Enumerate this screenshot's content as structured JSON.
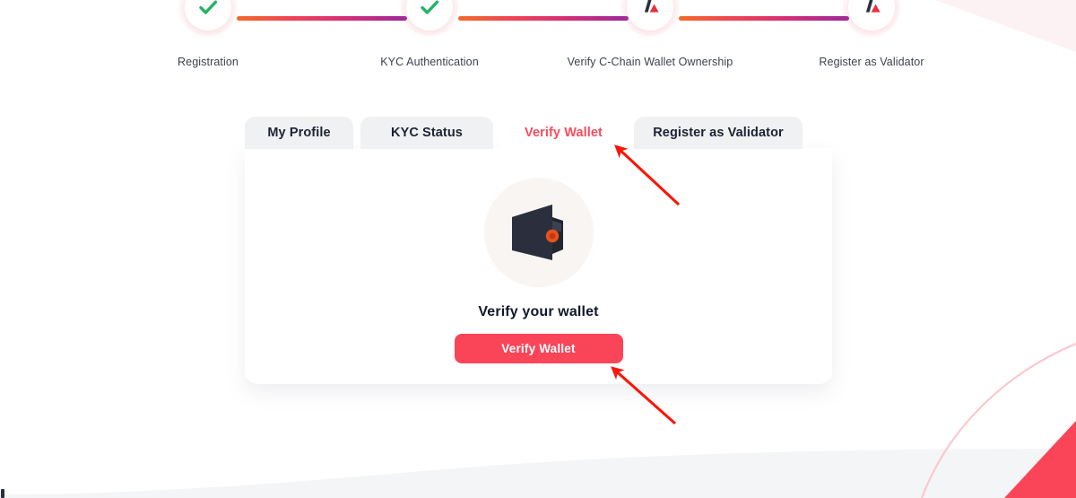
{
  "theme": {
    "accent_red": "#fa4558",
    "accent_red_text": "#fa4c5e",
    "check_green": "#24b364",
    "connector_start": "#f26a2b",
    "connector_mid": "#d62f74",
    "connector_end": "#9b2a9b",
    "tab_inactive_bg": "#f0f1f3",
    "card_bg": "#ffffff",
    "wallet_body": "#2b2f3d",
    "wallet_clasp": "#e8521f",
    "page_bg": "#ffffff",
    "annotation_arrow": "#fb1508"
  },
  "stepper": {
    "steps": [
      {
        "label": "Registration",
        "state": "complete",
        "icon": "check-icon"
      },
      {
        "label": "KYC Authentication",
        "state": "complete",
        "icon": "check-icon"
      },
      {
        "label": "Verify C-Chain Wallet Ownership",
        "state": "current",
        "icon": "avalanche-logo-icon"
      },
      {
        "label": "Register as Validator",
        "state": "upcoming",
        "icon": "avalanche-logo-icon"
      }
    ]
  },
  "tabs": [
    {
      "label": "My Profile",
      "active": false
    },
    {
      "label": "KYC Status",
      "active": false
    },
    {
      "label": "Verify Wallet",
      "active": true
    },
    {
      "label": "Register as Validator",
      "active": false
    }
  ],
  "card": {
    "illustration": "wallet-icon",
    "title": "Verify your wallet",
    "button_label": "Verify Wallet"
  },
  "annotations": [
    {
      "name": "arrow-to-verify-wallet-tab",
      "points_to": "Verify Wallet tab"
    },
    {
      "name": "arrow-to-verify-wallet-button",
      "points_to": "Verify Wallet button"
    }
  ]
}
